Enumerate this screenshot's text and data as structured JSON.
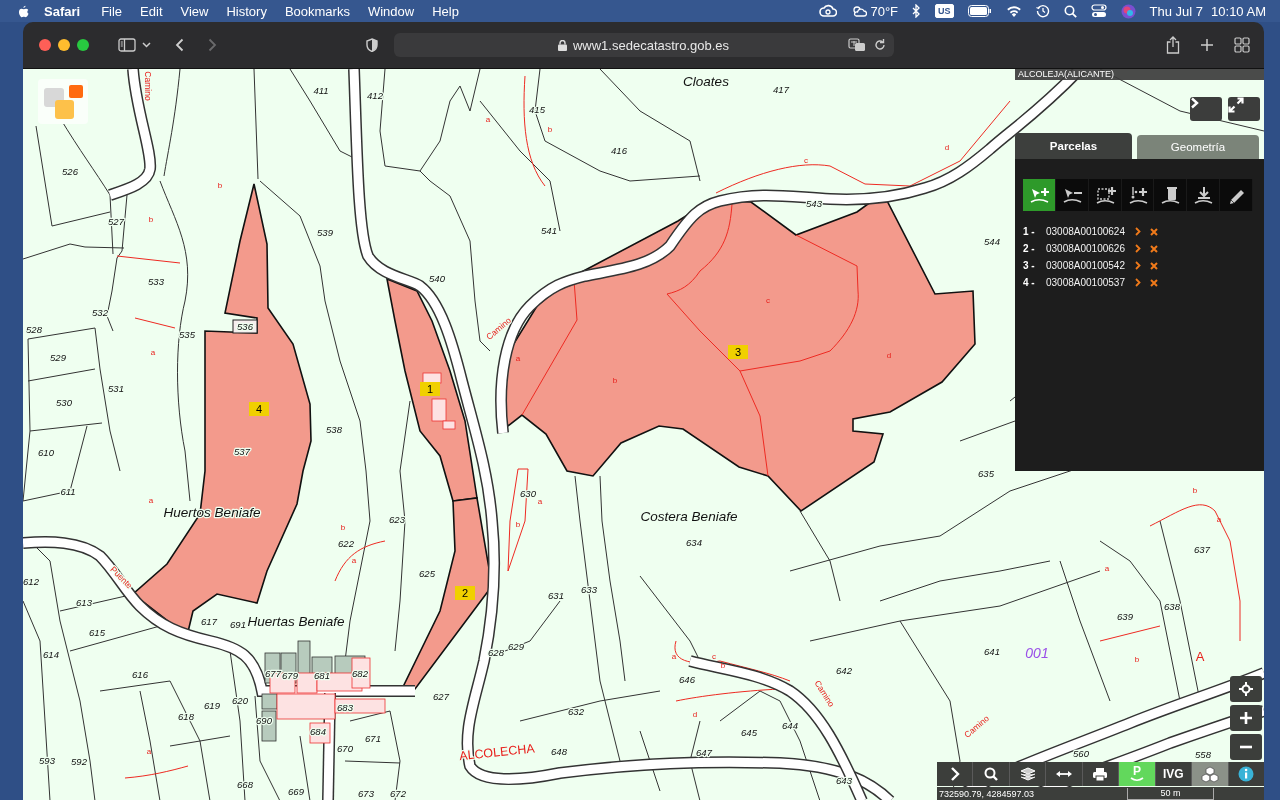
{
  "menubar": {
    "app": "Safari",
    "menus": [
      "File",
      "Edit",
      "View",
      "History",
      "Bookmarks",
      "Window",
      "Help"
    ],
    "status": {
      "temperature": "70°F",
      "keyboard": "US",
      "date": "Thu Jul 7",
      "time": "10:10 AM"
    }
  },
  "browser": {
    "url": "www1.sedecatastro.gob.es",
    "back_disabled": false,
    "forward_disabled": true
  },
  "map": {
    "municipality": "ALCOLEJA(ALICANTE)",
    "labels": [
      {
        "text": "Camino",
        "kind": "road"
      },
      {
        "text": "411",
        "kind": "parcel"
      },
      {
        "text": "412",
        "kind": "parcel"
      },
      {
        "text": "Cloates",
        "kind": "place"
      },
      {
        "text": "417",
        "kind": "parcel"
      },
      {
        "text": "a",
        "kind": "subparcel"
      },
      {
        "text": "415",
        "kind": "parcel"
      },
      {
        "text": "b",
        "kind": "subparcel"
      },
      {
        "text": "416",
        "kind": "parcel"
      },
      {
        "text": "526",
        "kind": "parcel"
      },
      {
        "text": "b",
        "kind": "subparcel"
      },
      {
        "text": "b",
        "kind": "subparcel"
      },
      {
        "text": "527",
        "kind": "parcel"
      },
      {
        "text": "539",
        "kind": "parcel"
      },
      {
        "text": "541",
        "kind": "parcel"
      },
      {
        "text": "c",
        "kind": "subparcel"
      },
      {
        "text": "d",
        "kind": "subparcel"
      },
      {
        "text": "543",
        "kind": "parcel"
      },
      {
        "text": "544",
        "kind": "parcel"
      },
      {
        "text": "533",
        "kind": "parcel"
      },
      {
        "text": "540",
        "kind": "parcel"
      },
      {
        "text": "532",
        "kind": "parcel"
      },
      {
        "text": "528",
        "kind": "parcel"
      },
      {
        "text": "535",
        "kind": "parcel"
      },
      {
        "text": "536",
        "kind": "boxed"
      },
      {
        "text": "Camino",
        "kind": "road"
      },
      {
        "text": "c",
        "kind": "subparcel"
      },
      {
        "text": "a",
        "kind": "subparcel"
      },
      {
        "text": "d",
        "kind": "subparcel"
      },
      {
        "text": "b",
        "kind": "subparcel"
      },
      {
        "text": "529",
        "kind": "parcel"
      },
      {
        "text": "a",
        "kind": "subparcel"
      },
      {
        "text": "531",
        "kind": "parcel"
      },
      {
        "text": "530",
        "kind": "parcel"
      },
      {
        "text": "538",
        "kind": "parcel"
      },
      {
        "text": "537",
        "kind": "parcel"
      },
      {
        "text": "610",
        "kind": "parcel"
      },
      {
        "text": "635",
        "kind": "parcel"
      },
      {
        "text": "611",
        "kind": "parcel"
      },
      {
        "text": "630",
        "kind": "parcel"
      },
      {
        "text": "a",
        "kind": "subparcel"
      },
      {
        "text": "a",
        "kind": "subparcel"
      },
      {
        "text": "Huertos Beniafe",
        "kind": "place"
      },
      {
        "text": "Costera Beniafe",
        "kind": "place"
      },
      {
        "text": "b",
        "kind": "subparcel"
      },
      {
        "text": "b",
        "kind": "subparcel"
      },
      {
        "text": "623",
        "kind": "parcel"
      },
      {
        "text": "634",
        "kind": "parcel"
      },
      {
        "text": "b",
        "kind": "subparcel"
      },
      {
        "text": "a",
        "kind": "subparcel"
      },
      {
        "text": "622",
        "kind": "parcel"
      },
      {
        "text": "637",
        "kind": "parcel"
      },
      {
        "text": "a",
        "kind": "subparcel"
      },
      {
        "text": "a",
        "kind": "subparcel"
      },
      {
        "text": "625",
        "kind": "parcel"
      },
      {
        "text": "612",
        "kind": "parcel"
      },
      {
        "text": "Puente",
        "kind": "road"
      },
      {
        "text": "633",
        "kind": "parcel"
      },
      {
        "text": "631",
        "kind": "parcel"
      },
      {
        "text": "613",
        "kind": "parcel"
      },
      {
        "text": "638",
        "kind": "parcel"
      },
      {
        "text": "639",
        "kind": "parcel"
      },
      {
        "text": "617",
        "kind": "parcel"
      },
      {
        "text": "691",
        "kind": "parcel"
      },
      {
        "text": "Huertas Beniafe",
        "kind": "place"
      },
      {
        "text": "615",
        "kind": "parcel"
      },
      {
        "text": "614",
        "kind": "parcel"
      },
      {
        "text": "628",
        "kind": "parcel"
      },
      {
        "text": "629",
        "kind": "parcel"
      },
      {
        "text": "a",
        "kind": "subparcel"
      },
      {
        "text": "c",
        "kind": "subparcel"
      },
      {
        "text": "b",
        "kind": "subparcel"
      },
      {
        "text": "641",
        "kind": "parcel"
      },
      {
        "text": "001",
        "kind": "sector"
      },
      {
        "text": "b",
        "kind": "subparcel"
      },
      {
        "text": "A",
        "kind": "letter"
      },
      {
        "text": "642",
        "kind": "parcel"
      },
      {
        "text": "616",
        "kind": "parcel"
      },
      {
        "text": "677",
        "kind": "parcel"
      },
      {
        "text": "679",
        "kind": "parcel"
      },
      {
        "text": "681",
        "kind": "parcel"
      },
      {
        "text": "682",
        "kind": "parcel"
      },
      {
        "text": "646",
        "kind": "parcel"
      },
      {
        "text": "Camino",
        "kind": "road"
      },
      {
        "text": "627",
        "kind": "parcel"
      },
      {
        "text": "620",
        "kind": "parcel"
      },
      {
        "text": "619",
        "kind": "parcel"
      },
      {
        "text": "683",
        "kind": "parcel"
      },
      {
        "text": "632",
        "kind": "parcel"
      },
      {
        "text": "d",
        "kind": "subparcel"
      },
      {
        "text": "618",
        "kind": "parcel"
      },
      {
        "text": "690",
        "kind": "parcel"
      },
      {
        "text": "644",
        "kind": "parcel"
      },
      {
        "text": "Camino",
        "kind": "road"
      },
      {
        "text": "645",
        "kind": "parcel"
      },
      {
        "text": "684",
        "kind": "parcel"
      },
      {
        "text": "671",
        "kind": "parcel"
      },
      {
        "text": "670",
        "kind": "parcel"
      },
      {
        "text": "a",
        "kind": "subparcel"
      },
      {
        "text": "ALCOLECHA",
        "kind": "town"
      },
      {
        "text": "648",
        "kind": "parcel"
      },
      {
        "text": "647",
        "kind": "parcel"
      },
      {
        "text": "593",
        "kind": "parcel"
      },
      {
        "text": "592",
        "kind": "parcel"
      },
      {
        "text": "560",
        "kind": "parcel"
      },
      {
        "text": "558",
        "kind": "parcel"
      },
      {
        "text": "643",
        "kind": "parcel"
      },
      {
        "text": "668",
        "kind": "parcel"
      },
      {
        "text": "669",
        "kind": "parcel"
      },
      {
        "text": "673",
        "kind": "parcel"
      },
      {
        "text": "672",
        "kind": "parcel"
      }
    ],
    "markers": [
      "1",
      "2",
      "3",
      "4"
    ],
    "coordinates": "732590.79, 4284597.03",
    "scale": "50 m"
  },
  "panel": {
    "tabs": [
      {
        "label": "Parcelas",
        "selected": true
      },
      {
        "label": "Geometría",
        "selected": false
      }
    ],
    "tools": [
      {
        "kind": "select-add",
        "selected": true
      },
      {
        "kind": "select-remove",
        "selected": false
      },
      {
        "kind": "box-add",
        "selected": false
      },
      {
        "kind": "point-add",
        "selected": false
      },
      {
        "kind": "delete",
        "selected": false
      },
      {
        "kind": "download",
        "selected": false
      },
      {
        "kind": "edit",
        "selected": false
      }
    ],
    "parcels": [
      {
        "number": "1 -",
        "reference": "03008A00100624"
      },
      {
        "number": "2 -",
        "reference": "03008A00100626"
      },
      {
        "number": "3 -",
        "reference": "03008A00100542"
      },
      {
        "number": "4 -",
        "reference": "03008A00100537"
      }
    ]
  },
  "toolbar": [
    {
      "kind": "expand",
      "selected": false,
      "disabled": false
    },
    {
      "kind": "search",
      "selected": false,
      "disabled": false
    },
    {
      "kind": "layers",
      "selected": false,
      "disabled": false
    },
    {
      "kind": "measure",
      "selected": false,
      "disabled": false
    },
    {
      "kind": "print",
      "selected": false,
      "disabled": false
    },
    {
      "kind": "parking",
      "label": "P",
      "selected": true,
      "disabled": false
    },
    {
      "kind": "text",
      "label": "IVG",
      "selected": false,
      "disabled": false
    },
    {
      "kind": "cubes",
      "selected": false,
      "disabled": true
    },
    {
      "kind": "info",
      "selected": false,
      "disabled": false
    }
  ]
}
